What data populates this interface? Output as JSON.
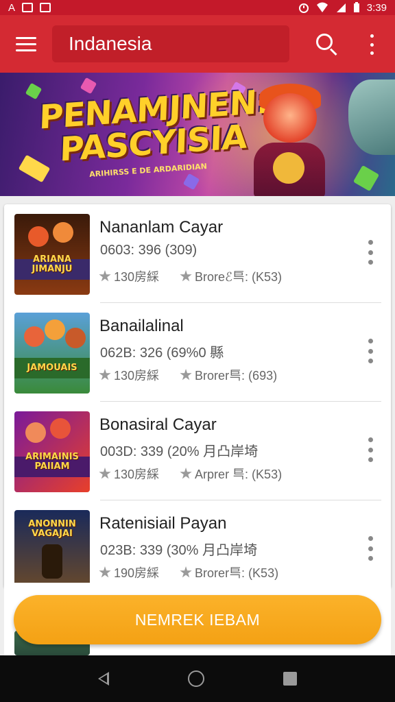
{
  "status_bar": {
    "left_icons": [
      "notification-a-icon",
      "notification-g-icon",
      "notification-square-icon"
    ],
    "left_text": "A",
    "time": "3:39",
    "right_icons": [
      "alarm-icon",
      "wifi-icon",
      "signal-icon",
      "battery-icon"
    ]
  },
  "app_bar": {
    "title": "Indanesia",
    "background": "#d42a33",
    "icons": [
      "menu-icon",
      "search-icon",
      "more-vert-icon"
    ]
  },
  "banner": {
    "title_line1": "PENAMJNEN:",
    "title_line2": "PASCYISIA",
    "subtitle": "ARIHIRSS E DE ARDARIDIAN"
  },
  "list": {
    "items": [
      {
        "name": "Nananlam Cayar",
        "meta": "0603: 396 (309)",
        "rating": "130房綵",
        "extra": "Broreℰ巪: (K53)",
        "thumb_text": "ARIANA JIMANJU",
        "thumb_colors": [
          "#5a2a12",
          "#c8541e"
        ]
      },
      {
        "name": "Banailalinal",
        "meta": "062B: 326 (69%0 縣",
        "rating": "130房綵",
        "extra": "Brorer巪: (693)",
        "thumb_text": "JAMOUAIS",
        "thumb_colors": [
          "#3a7a3a",
          "#e86a28"
        ]
      },
      {
        "name": "Bonasiral Cayar",
        "meta": "003D: 339 (20% 月凸岸埼",
        "rating": "130房綵",
        "extra": "Arprer 巪: (K53)",
        "thumb_text": "ARIMAINIS PAIIAM",
        "thumb_colors": [
          "#6a1a8a",
          "#e44a3a"
        ]
      },
      {
        "name": "Ratenisiail Payan",
        "meta": "023B: 339 (30% 月凸岸埼",
        "rating": "190房綵",
        "extra": "Brorer巪: (K53)",
        "thumb_text": "ANONNIN VAGAJAI",
        "thumb_colors": [
          "#1a3a6a",
          "#b8742a"
        ]
      }
    ]
  },
  "cta": {
    "label": "NEMREK IEBAM",
    "color": "#f6a51a"
  },
  "nav_bar": {
    "icons": [
      "back-icon",
      "home-icon",
      "recents-icon"
    ]
  }
}
